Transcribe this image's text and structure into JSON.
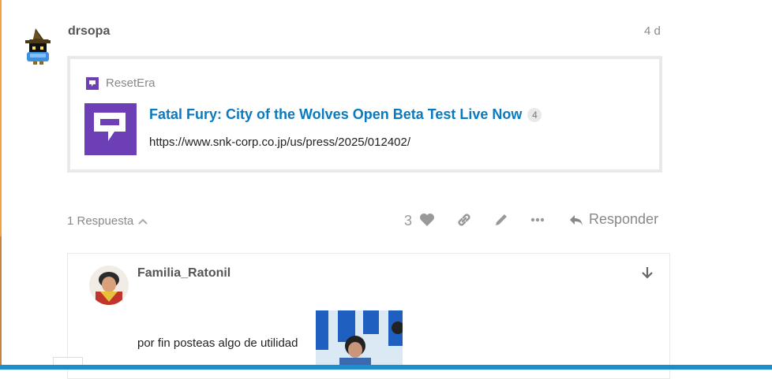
{
  "post": {
    "username": "drsopa",
    "date": "4 d",
    "onebox": {
      "site_name": "ResetEra",
      "title": "Fatal Fury: City of the Wolves Open Beta Test Live Now",
      "count": "4",
      "url": "https://www.snk-corp.co.jp/us/press/2025/012402/"
    },
    "replies_label": "1 Respuesta",
    "like_count": "3",
    "reply_label": "Responder"
  },
  "reply": {
    "username": "Familia_Ratonil",
    "text": "por fin posteas algo de utilidad"
  },
  "colors": {
    "link": "#0a7ac0",
    "resetera_purple": "#6c3fb6",
    "muted": "#888888",
    "border": "#e9e9e9",
    "bottom_bar": "#1a8fcc"
  },
  "icons": [
    "black-mage-avatar-icon",
    "resetera-icon",
    "chevron-up-icon",
    "heart-icon",
    "link-icon",
    "pencil-icon",
    "more-dots-icon",
    "reply-arrow-icon",
    "arrow-down-icon"
  ]
}
